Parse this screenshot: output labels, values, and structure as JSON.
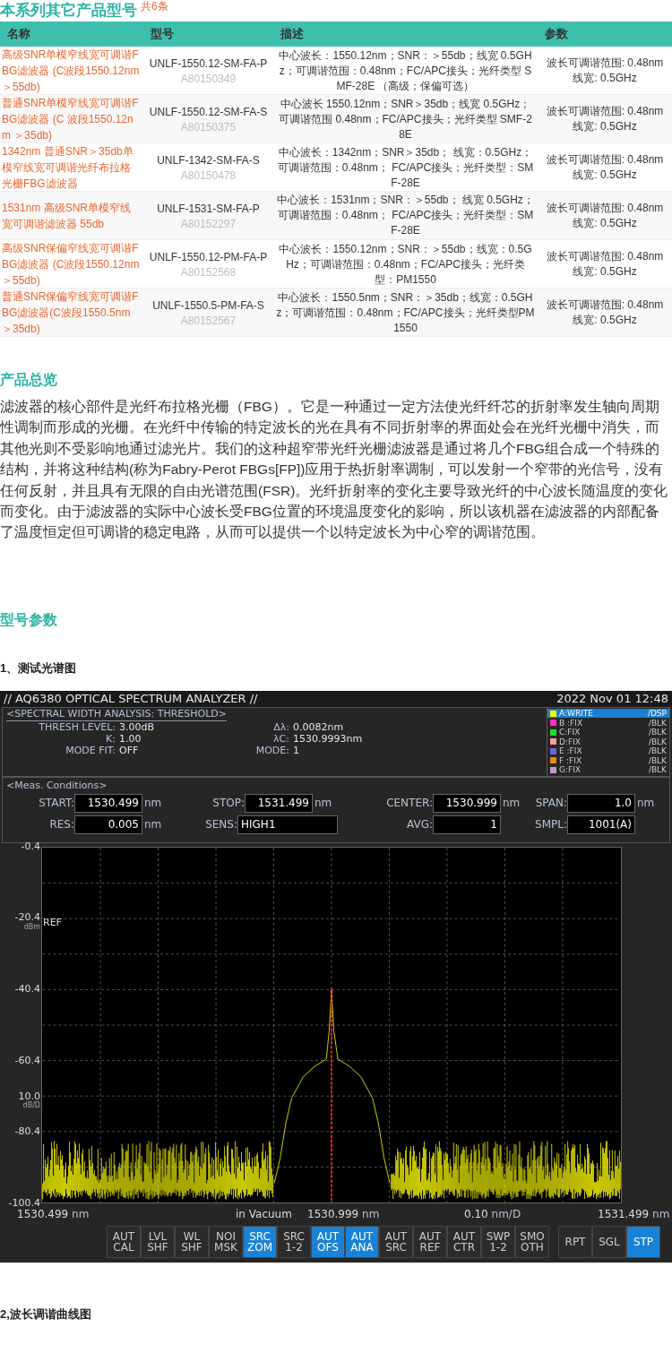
{
  "related": {
    "title": "本系列其它产品型号",
    "count": "共6条",
    "columns": [
      "名称",
      "型号",
      "描述",
      "参数"
    ],
    "rows": [
      {
        "name": "高级SNR单模窄线宽可调谐FBG滤波器 (C波段1550.12nm ＞55db)",
        "model": "UNLF-1550.12-SM-FA-P",
        "code": "A80150349",
        "description": "中心波长：1550.12nm；SNR：＞55db；线宽 0.5GHz；可调谐范围：0.48nm；FC/APC接头；光纤类型 SMF-28E （高级；保偏可选）",
        "params": [
          "波长可调谐范围: 0.48nm",
          "线宽: 0.5GHz"
        ]
      },
      {
        "name": "普通SNR单模窄线宽可调谐FBG滤波器 (C 波段1550.12nm ＞35db)",
        "model": "UNLF-1550.12-SM-FA-S",
        "code": "A80150375",
        "description": "中心波长 1550.12nm；SNR＞35db；线宽 0.5GHz；可调谐范围 0.48nm；FC/APC接头；光纤类型 SMF-28E",
        "params": [
          "波长可调谐范围: 0.48nm",
          "线宽: 0.5GHz"
        ]
      },
      {
        "name": "1342nm 普通SNR＞35db单模窄线宽可调谐光纤布拉格光栅FBG滤波器",
        "model": "UNLF-1342-SM-FA-S",
        "code": "A80150478",
        "description": "中心波长：1342nm；SNR＞35db； 线宽：0.5GHz；可调谐范围：0.48nm； FC/APC接头；光纤类型：SMF-28E",
        "params": [
          "波长可调谐范围: 0.48nm",
          "线宽: 0.5GHz"
        ]
      },
      {
        "name": "1531nm 高级SNR单模窄线宽可调谐滤波器 55db",
        "model": "UNLF-1531-SM-FA-P",
        "code": "A80152297",
        "description": "中心波长：1531nm；SNR：＞55db； 线宽 0.5GHz；可调谐范围：0.48nm； FC/APC接头；光纤类型：SMF-28E",
        "params": [
          "波长可调谐范围: 0.48nm",
          "线宽: 0.5GHz"
        ]
      },
      {
        "name": "高级SNR保偏窄线宽可调谐FBG滤波器 (C波段1550.12nm ＞55db)",
        "model": "UNLF-1550.12-PM-FA-P",
        "code": "A80152568",
        "description": "中心波长：1550.12nm；SNR：＞55db；线宽：0.5GHz；可调谐范围：0.48nm；FC/APC接头；光纤类型：PM1550",
        "params": [
          "波长可调谐范围: 0.48nm",
          "线宽: 0.5GHz"
        ]
      },
      {
        "name": "普通SNR保偏窄线宽可调谐FBG滤波器(C波段1550.5nm ＞35db)",
        "model": "UNLF-1550.5-PM-FA-S",
        "code": "A80152567",
        "description": "中心波长：1550.5nm；SNR：＞35db；线宽：0.5GHz；可调谐范围：0.48nm；FC/APC接头；光纤类型PM1550",
        "params": [
          "波长可调谐范围: 0.48nm",
          "线宽: 0.5GHz"
        ]
      }
    ]
  },
  "overview": {
    "heading": "产品总览",
    "paragraph": "滤波器的核心部件是光纤布拉格光栅（FBG）。它是一种通过一定方法使光纤纤芯的折射率发生轴向周期性调制而形成的光栅。在光纤中传输的特定波长的光在具有不同折射率的界面处会在光纤光栅中消失，而其他光则不受影响地通过滤光片。我们的这种超窄带光纤光栅滤波器是通过将几个FBG组合成一个特殊的结构，并将这种结构(称为Fabry-Perot FBGs[FP])应用于热折射率调制，可以发射一个窄带的光信号，没有任何反射，并且具有无限的自由光谱范围(FSR)。光纤折射率的变化主要导致光纤的中心波长随温度的变化而变化。由于滤波器的实际中心波长受FBG位置的环境温度变化的影响，所以该机器在滤波器的内部配备了温度恒定但可调谐的稳定电路，从而可以提供一个以特定波长为中心窄的调谐范围。"
  },
  "specs": {
    "heading": "型号参数",
    "subheading": "1、测试光谱图",
    "analyzer": {
      "title": "// AQ6380 OPTICAL SPECTRUM ANALYZER //",
      "datetime": "2022 Nov 01 12:48",
      "analysis": {
        "title": "<SPECTRAL WIDTH ANALYSIS: THRESHOLD>",
        "left": [
          {
            "label": "THRESH LEVEL:",
            "value": "3.00dB"
          },
          {
            "label": "K:",
            "value": "1.00"
          },
          {
            "label": "MODE FIT:",
            "value": "OFF"
          }
        ],
        "right": [
          {
            "label": "Δλ:",
            "value": "0.0082nm"
          },
          {
            "label": "λC:",
            "value": "1530.9993nm"
          },
          {
            "label": "MODE:",
            "value": "1"
          }
        ]
      },
      "traces": [
        {
          "name": "A:WRITE",
          "status": "/DSP",
          "color": "#ffff00",
          "selected": true
        },
        {
          "name": "B :FIX",
          "status": "/BLK",
          "color": "#ff33cc",
          "selected": false
        },
        {
          "name": "C:FIX",
          "status": "/BLK",
          "color": "#22dd22",
          "selected": false
        },
        {
          "name": "D:FIX",
          "status": "/BLK",
          "color": "#f0a090",
          "selected": false
        },
        {
          "name": "E :FIX",
          "status": "/BLK",
          "color": "#6666dd",
          "selected": false
        },
        {
          "name": "F :FIX",
          "status": "/BLK",
          "color": "#f08a10",
          "selected": false
        },
        {
          "name": "G:FIX",
          "status": "/BLK",
          "color": "#cc99cc",
          "selected": false
        }
      ],
      "conditions": {
        "title": "<Meas. Conditions>",
        "fields": [
          {
            "label": "START:",
            "value": "1530.499",
            "unit": "nm",
            "kind": "number"
          },
          {
            "label": "STOP:",
            "value": "1531.499",
            "unit": "nm",
            "kind": "number"
          },
          {
            "label": "CENTER:",
            "value": "1530.999",
            "unit": "nm",
            "kind": "number"
          },
          {
            "label": "SPAN:",
            "value": "1.0",
            "unit": "nm",
            "kind": "number"
          },
          {
            "label": "RES:",
            "value": "0.005",
            "unit": "nm",
            "kind": "number"
          },
          {
            "label": "SENS:",
            "value": "HIGH1",
            "kind": "text"
          },
          {
            "label": "AVG:",
            "value": "1",
            "kind": "number"
          },
          {
            "label": "SMPL:",
            "value": "1001(A)",
            "kind": "number"
          }
        ]
      },
      "chart_data": {
        "type": "line",
        "x": [
          1530.9,
          1530.91,
          1530.92,
          1530.93,
          1530.95,
          1530.97,
          1530.99,
          1530.995,
          1530.999,
          1531.003,
          1531.01,
          1531.03,
          1531.05,
          1531.07,
          1531.08,
          1531.09,
          1531.1
        ],
        "series": [
          {
            "color": "#ffff00",
            "values": [
              -95,
              -88,
              -78,
              -71,
              -65,
              -62,
              -60,
              -52,
              -40.4,
              -52,
              -60,
              -62,
              -65,
              -71,
              -78,
              -88,
              -95
            ]
          }
        ],
        "xlim": [
          1530.499,
          1531.499
        ],
        "ylim": [
          -100.4,
          -0.4
        ],
        "xticks": [
          {
            "value": 1530.499,
            "label": "1530.499"
          },
          {
            "value": 1530.999,
            "label": "1530.999"
          },
          {
            "value": 1531.499,
            "label": "1531.499"
          }
        ],
        "grid": true,
        "ref_lines": [
          {
            "axis": "x",
            "value": 1530.999,
            "color": "#ff2020"
          }
        ],
        "yticks": [
          {
            "value": -0.4,
            "label": "-0.4"
          },
          {
            "value": -20.4,
            "label": "-20.4"
          },
          {
            "value": -40.4,
            "label": "-40.4"
          },
          {
            "value": -60.4,
            "label": "-60.4"
          },
          {
            "value": -80.4,
            "label": "-80.4"
          },
          {
            "value": -100.4,
            "label": "-100.4"
          }
        ]
      },
      "y_reference": {
        "label": "REF",
        "unit": "dBm"
      },
      "y_scale": {
        "value": "10.0",
        "unit": "dB/D"
      },
      "x_tick_units": [
        "nm",
        "nm",
        "nm"
      ],
      "x_medium": "in Vacuum",
      "x_scale": {
        "value": "0.10",
        "unit": "nm/D"
      },
      "soft_keys": [
        {
          "lines": [
            "AUT",
            "CAL"
          ],
          "selected": false
        },
        {
          "lines": [
            "LVL",
            "SHF"
          ],
          "selected": false
        },
        {
          "lines": [
            "WL",
            "SHF"
          ],
          "selected": false
        },
        {
          "lines": [
            "NOI",
            "MSK"
          ],
          "selected": false
        },
        {
          "lines": [
            "SRC",
            "ZOM"
          ],
          "selected": true
        },
        {
          "lines": [
            "SRC",
            "1-2"
          ],
          "selected": false
        },
        {
          "lines": [
            "AUT",
            "OFS"
          ],
          "selected": true
        },
        {
          "lines": [
            "AUT",
            "ANA"
          ],
          "selected": true
        },
        {
          "lines": [
            "AUT",
            "SRC"
          ],
          "selected": false
        },
        {
          "lines": [
            "AUT",
            "REF"
          ],
          "selected": false
        },
        {
          "lines": [
            "AUT",
            "CTR"
          ],
          "selected": false
        },
        {
          "lines": [
            "SWP",
            "1-2"
          ],
          "selected": false
        },
        {
          "lines": [
            "SMO",
            "OTH"
          ],
          "selected": false
        }
      ],
      "run_keys": [
        {
          "label": "RPT",
          "selected": false
        },
        {
          "label": "SGL",
          "selected": false
        },
        {
          "label": "STP",
          "selected": true
        }
      ]
    }
  },
  "next_subheading": "2,波长调谐曲线图"
}
